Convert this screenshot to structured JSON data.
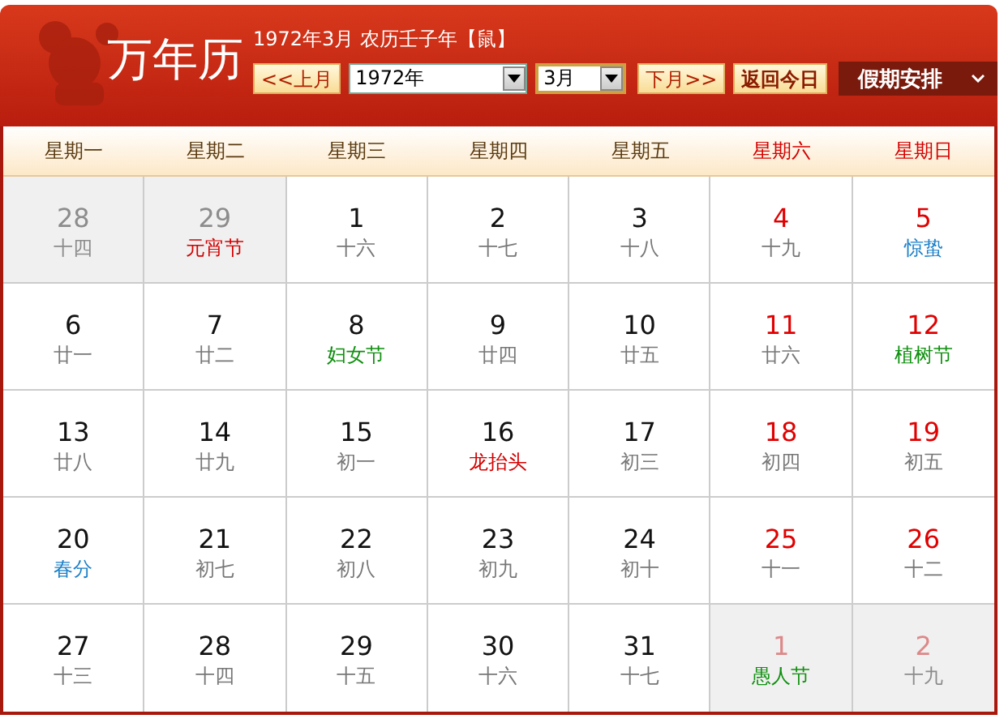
{
  "header": {
    "logo": "万年历",
    "title": "1972年3月 农历壬子年【鼠】",
    "prev_button": "<<上月",
    "year_select": "1972年",
    "month_select": "3月",
    "next_button": "下月>>",
    "today_button": "返回今日",
    "holiday_menu": "假期安排"
  },
  "weekdays": [
    {
      "label": "星期一",
      "weekend": false
    },
    {
      "label": "星期二",
      "weekend": false
    },
    {
      "label": "星期三",
      "weekend": false
    },
    {
      "label": "星期四",
      "weekend": false
    },
    {
      "label": "星期五",
      "weekend": false
    },
    {
      "label": "星期六",
      "weekend": true
    },
    {
      "label": "星期日",
      "weekend": true
    }
  ],
  "days": [
    {
      "day": "28",
      "sub": "十四",
      "kind": "lunar",
      "other_month": true,
      "weekend": false
    },
    {
      "day": "29",
      "sub": "元宵节",
      "kind": "holiday",
      "other_month": true,
      "weekend": false
    },
    {
      "day": "1",
      "sub": "十六",
      "kind": "lunar",
      "other_month": false,
      "weekend": false
    },
    {
      "day": "2",
      "sub": "十七",
      "kind": "lunar",
      "other_month": false,
      "weekend": false
    },
    {
      "day": "3",
      "sub": "十八",
      "kind": "lunar",
      "other_month": false,
      "weekend": false
    },
    {
      "day": "4",
      "sub": "十九",
      "kind": "lunar",
      "other_month": false,
      "weekend": true
    },
    {
      "day": "5",
      "sub": "惊蛰",
      "kind": "solar-term",
      "other_month": false,
      "weekend": true
    },
    {
      "day": "6",
      "sub": "廿一",
      "kind": "lunar",
      "other_month": false,
      "weekend": false
    },
    {
      "day": "7",
      "sub": "廿二",
      "kind": "lunar",
      "other_month": false,
      "weekend": false
    },
    {
      "day": "8",
      "sub": "妇女节",
      "kind": "festival",
      "other_month": false,
      "weekend": false
    },
    {
      "day": "9",
      "sub": "廿四",
      "kind": "lunar",
      "other_month": false,
      "weekend": false
    },
    {
      "day": "10",
      "sub": "廿五",
      "kind": "lunar",
      "other_month": false,
      "weekend": false
    },
    {
      "day": "11",
      "sub": "廿六",
      "kind": "lunar",
      "other_month": false,
      "weekend": true
    },
    {
      "day": "12",
      "sub": "植树节",
      "kind": "festival",
      "other_month": false,
      "weekend": true
    },
    {
      "day": "13",
      "sub": "廿八",
      "kind": "lunar",
      "other_month": false,
      "weekend": false
    },
    {
      "day": "14",
      "sub": "廿九",
      "kind": "lunar",
      "other_month": false,
      "weekend": false
    },
    {
      "day": "15",
      "sub": "初一",
      "kind": "lunar",
      "other_month": false,
      "weekend": false
    },
    {
      "day": "16",
      "sub": "龙抬头",
      "kind": "holiday",
      "other_month": false,
      "weekend": false
    },
    {
      "day": "17",
      "sub": "初三",
      "kind": "lunar",
      "other_month": false,
      "weekend": false
    },
    {
      "day": "18",
      "sub": "初四",
      "kind": "lunar",
      "other_month": false,
      "weekend": true
    },
    {
      "day": "19",
      "sub": "初五",
      "kind": "lunar",
      "other_month": false,
      "weekend": true
    },
    {
      "day": "20",
      "sub": "春分",
      "kind": "solar-term",
      "other_month": false,
      "weekend": false
    },
    {
      "day": "21",
      "sub": "初七",
      "kind": "lunar",
      "other_month": false,
      "weekend": false
    },
    {
      "day": "22",
      "sub": "初八",
      "kind": "lunar",
      "other_month": false,
      "weekend": false
    },
    {
      "day": "23",
      "sub": "初九",
      "kind": "lunar",
      "other_month": false,
      "weekend": false
    },
    {
      "day": "24",
      "sub": "初十",
      "kind": "lunar",
      "other_month": false,
      "weekend": false
    },
    {
      "day": "25",
      "sub": "十一",
      "kind": "lunar",
      "other_month": false,
      "weekend": true
    },
    {
      "day": "26",
      "sub": "十二",
      "kind": "lunar",
      "other_month": false,
      "weekend": true
    },
    {
      "day": "27",
      "sub": "十三",
      "kind": "lunar",
      "other_month": false,
      "weekend": false
    },
    {
      "day": "28",
      "sub": "十四",
      "kind": "lunar",
      "other_month": false,
      "weekend": false
    },
    {
      "day": "29",
      "sub": "十五",
      "kind": "lunar",
      "other_month": false,
      "weekend": false
    },
    {
      "day": "30",
      "sub": "十六",
      "kind": "lunar",
      "other_month": false,
      "weekend": false
    },
    {
      "day": "31",
      "sub": "十七",
      "kind": "lunar",
      "other_month": false,
      "weekend": false
    },
    {
      "day": "1",
      "sub": "愚人节",
      "kind": "festival",
      "other_month": true,
      "weekend": true
    },
    {
      "day": "2",
      "sub": "十九",
      "kind": "lunar",
      "other_month": true,
      "weekend": true
    }
  ]
}
